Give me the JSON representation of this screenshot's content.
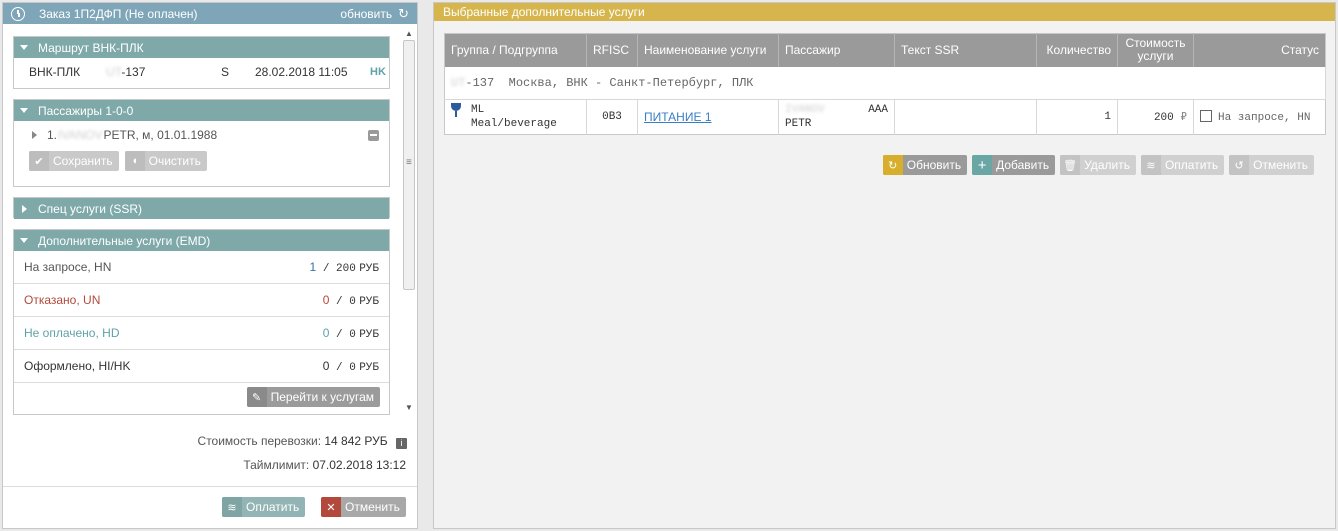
{
  "order": {
    "title": "Заказ 1П2ДФП (Не оплачен)",
    "refresh_label": "обновить"
  },
  "route": {
    "header": "Маршрут ВНК-ПЛК",
    "segment": "ВНК-ПЛК",
    "flight_prefix": "UT",
    "flight_suffix": "-137",
    "class": "S",
    "datetime": "28.02.2018 11:05",
    "status": "HK"
  },
  "passengers": {
    "header": "Пассажиры 1-0-0",
    "item_prefix": "1.",
    "item_blurred": "IVANOV",
    "item_rest": "PETR, м, 01.01.1988",
    "save_label": "Сохранить",
    "clear_label": "Очистить"
  },
  "ssr": {
    "header": "Спец услуги (SSR)"
  },
  "emd": {
    "header": "Дополнительные услуги (EMD)",
    "rows": [
      {
        "label": "На запросе, HN",
        "count": "1",
        "amount": "200",
        "currency": "РУБ",
        "color": "#555555",
        "count_color": "#3a6fa8"
      },
      {
        "label": "Отказано, UN",
        "count": "0",
        "amount": "0",
        "currency": "РУБ",
        "color": "#b3493b",
        "count_color": "#b3493b"
      },
      {
        "label": "Не оплачено, HD",
        "count": "0",
        "amount": "0",
        "currency": "РУБ",
        "color": "#5fa2a8",
        "count_color": "#5fa2a8"
      },
      {
        "label": "Оформлено, HI/HK",
        "count": "0",
        "amount": "0",
        "currency": "РУБ",
        "color": "#333333",
        "count_color": "#333333"
      }
    ],
    "goto_label": "Перейти к услугам"
  },
  "totals": {
    "cost_label": "Стоимость перевозки:",
    "cost_value": "14 842 РУБ",
    "timelimit_label": "Таймлимит:",
    "timelimit_value": "07.02.2018 13:12"
  },
  "left_actions": {
    "pay_label": "Оплатить",
    "cancel_label": "Отменить"
  },
  "services": {
    "header": "Выбранные дополнительные услуги",
    "columns": [
      "Группа / Подгруппа",
      "RFISC",
      "Наименование услуги",
      "Пассажир",
      "Текст SSR",
      "Количество",
      "Стоимость услуги",
      "Статус"
    ],
    "segment_blurred": "UT",
    "segment_text": "-137  Москва, ВНК - Санкт-Петербург, ПЛК",
    "row": {
      "group": "ML",
      "subgroup": "Meal/beverage",
      "rfisc": "0B3",
      "name": "ПИТАНИЕ 1",
      "passenger_blurred": "IVANOV",
      "passenger_code": "AAA",
      "passenger_name": "PETR",
      "ssr_text": "",
      "quantity": "1",
      "price": "200",
      "currency_sign": "₽",
      "status": "На запросе, HN"
    },
    "actions": {
      "refresh_label": "Обновить",
      "add_label": "Добавить",
      "delete_label": "Удалить",
      "pay_label": "Оплатить",
      "cancel_label": "Отменить"
    }
  }
}
